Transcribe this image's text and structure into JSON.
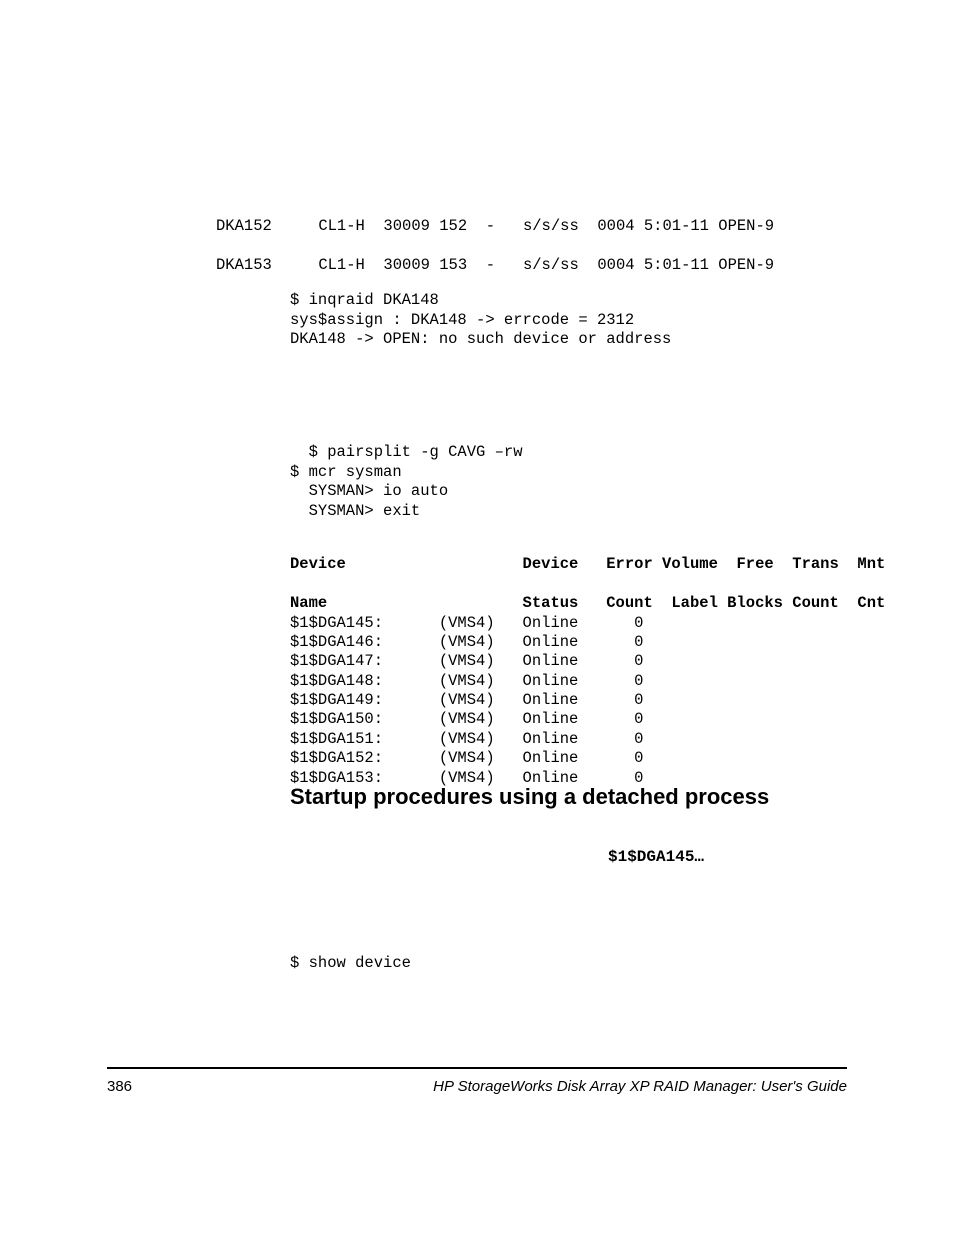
{
  "block1_line1": "DKA152     CL1-H  30009 152  -   s/s/ss  0004 5:01-11 OPEN-9",
  "block1_line2": "DKA153     CL1-H  30009 153  -   s/s/ss  0004 5:01-11 OPEN-9",
  "block2_line1": "$ inqraid DKA148",
  "block2_line2": "sys$assign : DKA148 -> errcode = 2312",
  "block2_line3": "DKA148 -> OPEN: no such device or address",
  "block3_line1": "  $ pairsplit -g CAVG –rw",
  "block3_line2": "$ mcr sysman",
  "block3_line3": "  SYSMAN> io auto",
  "block3_line4": "  SYSMAN> exit",
  "tbl_hdr1": "Device                   Device   Error Volume  Free  Trans  Mnt",
  "tbl_hdr2": "Name                     Status   Count  Label Blocks Count  Cnt",
  "tbl_r1": "$1$DGA145:      (VMS4)   Online      0",
  "tbl_r2": "$1$DGA146:      (VMS4)   Online      0",
  "tbl_r3": "$1$DGA147:      (VMS4)   Online      0",
  "tbl_r4": "$1$DGA148:      (VMS4)   Online      0",
  "tbl_r5": "$1$DGA149:      (VMS4)   Online      0",
  "tbl_r6": "$1$DGA150:      (VMS4)   Online      0",
  "tbl_r7": "$1$DGA151:      (VMS4)   Online      0",
  "tbl_r8": "$1$DGA152:      (VMS4)   Online      0",
  "tbl_r9": "$1$DGA153:      (VMS4)   Online      0",
  "heading": "Startup procedures using a detached process",
  "bold_label": "$1$DGA145…",
  "block5": "$ show device",
  "page_num": "386",
  "footer_title": "HP StorageWorks Disk Array XP RAID Manager: User's Guide"
}
